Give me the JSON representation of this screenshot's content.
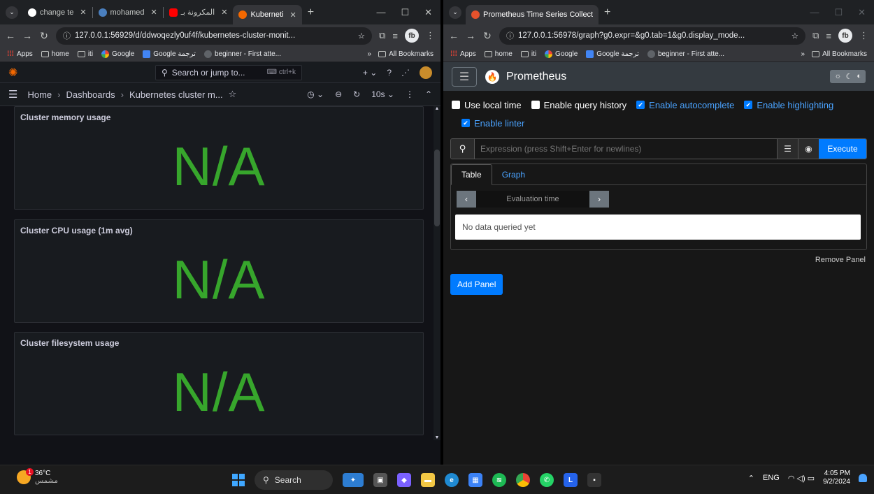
{
  "left": {
    "tabs": [
      {
        "title": "change te",
        "active": false
      },
      {
        "title": "mohamed",
        "active": false
      },
      {
        "title": "المكرونة بـ",
        "active": false
      },
      {
        "title": "Kuberneti",
        "active": true
      }
    ],
    "url": "127.0.0.1:56929/d/ddwoqezly0uf4f/kubernetes-cluster-monit...",
    "bookmarks": [
      "Apps",
      "home",
      "iti",
      "Google",
      "Google ترجمة",
      "beginner - First atte..."
    ],
    "all_bookmarks": "All Bookmarks",
    "grafana": {
      "search_placeholder": "Search or jump to...",
      "search_shortcut": "ctrl+k",
      "breadcrumb": [
        "Home",
        "Dashboards",
        "Kubernetes cluster m..."
      ],
      "refresh_interval": "10s",
      "panels": [
        {
          "title": "Cluster memory usage",
          "value": "N/A"
        },
        {
          "title": "Cluster CPU usage (1m avg)",
          "value": "N/A"
        },
        {
          "title": "Cluster filesystem usage",
          "value": "N/A"
        }
      ]
    }
  },
  "right": {
    "tab_title": "Prometheus Time Series Collect",
    "url": "127.0.0.1:56978/graph?g0.expr=&g0.tab=1&g0.display_mode...",
    "bookmarks": [
      "Apps",
      "home",
      "iti",
      "Google",
      "Google ترجمة",
      "beginner - First atte..."
    ],
    "all_bookmarks": "All Bookmarks",
    "prometheus": {
      "brand": "Prometheus",
      "options": [
        {
          "label": "Use local time",
          "checked": false
        },
        {
          "label": "Enable query history",
          "checked": false
        },
        {
          "label": "Enable autocomplete",
          "checked": true
        },
        {
          "label": "Enable highlighting",
          "checked": true
        },
        {
          "label": "Enable linter",
          "checked": true
        }
      ],
      "expression_placeholder": "Expression (press Shift+Enter for newlines)",
      "execute_label": "Execute",
      "tabs": [
        "Table",
        "Graph"
      ],
      "evaluation_time_placeholder": "Evaluation time",
      "no_data": "No data queried yet",
      "remove_panel": "Remove Panel",
      "add_panel": "Add Panel"
    }
  },
  "taskbar": {
    "temperature": "36°C",
    "weather_label": "مشمس",
    "weather_badge": "1",
    "search_label": "Search",
    "language": "ENG",
    "time": "4:05 PM",
    "date": "9/2/2024"
  }
}
